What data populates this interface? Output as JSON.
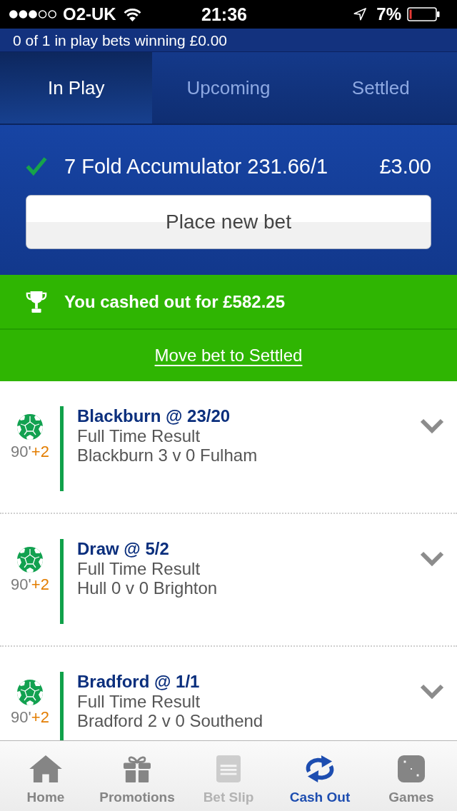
{
  "status_bar": {
    "carrier": "O2-UK",
    "time": "21:36",
    "battery": "7%"
  },
  "summary": "0 of 1 in play bets winning £0.00",
  "tabs": [
    {
      "label": "In Play",
      "selected": true
    },
    {
      "label": "Upcoming",
      "selected": false
    },
    {
      "label": "Settled",
      "selected": false
    }
  ],
  "bet": {
    "won": true,
    "title": "7 Fold Accumulator 231.66/1",
    "stake": "£3.00",
    "button": "Place new bet"
  },
  "cash_out": {
    "message": "You cashed out for £582.25",
    "link": "Move bet to Settled"
  },
  "selections": [
    {
      "title": "Blackburn @ 23/20",
      "market": "Full Time Result",
      "score": "Blackburn 3 v 0 Fulham",
      "minute": "90'",
      "added_time": "+2"
    },
    {
      "title": "Draw @ 5/2",
      "market": "Full Time Result",
      "score": "Hull 0 v 0 Brighton",
      "minute": "90'",
      "added_time": "+2"
    },
    {
      "title": "Bradford @ 1/1",
      "market": "Full Time Result",
      "score": "Bradford 2 v 0 Southend",
      "minute": "90'",
      "added_time": "+2"
    }
  ],
  "tab_bar": [
    {
      "label": "Home",
      "selected": false,
      "disabled": false
    },
    {
      "label": "Promotions",
      "selected": false,
      "disabled": false
    },
    {
      "label": "Bet Slip",
      "selected": false,
      "disabled": true
    },
    {
      "label": "Cash Out",
      "selected": true,
      "disabled": false
    },
    {
      "label": "Games",
      "selected": false,
      "disabled": false
    }
  ]
}
